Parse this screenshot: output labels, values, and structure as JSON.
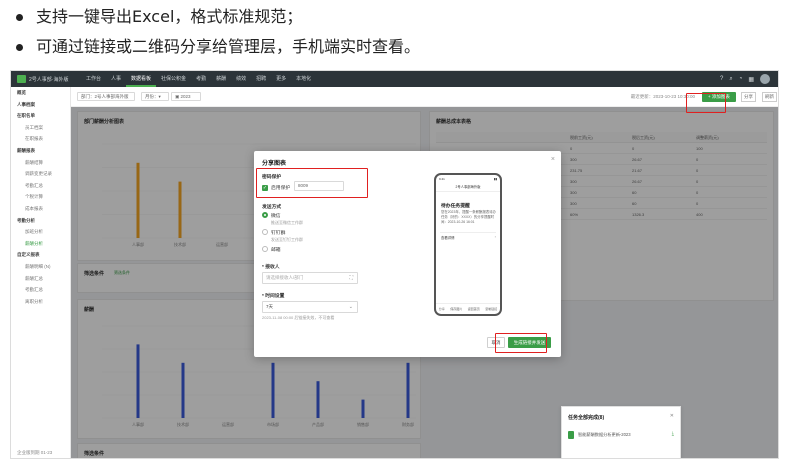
{
  "bullets": [
    "支持一键导出Excel，格式标准规范；",
    "可通过链接或二维码分享给管理层，手机端实时查看。"
  ],
  "topbar": {
    "app_name": "2号人事部·海外版",
    "nav": [
      "工作台",
      "人事",
      "数据看板",
      "社保公积金",
      "考勤",
      "薪酬",
      "绩效",
      "招聘",
      "更多",
      "本地化"
    ],
    "active_nav": "数据看板"
  },
  "sidebar": {
    "items": [
      {
        "label": "概览",
        "type": "group"
      },
      {
        "label": "人事档案",
        "type": "group"
      },
      {
        "label": "在职名单",
        "type": "group"
      },
      {
        "label": "员工档案",
        "type": "sub"
      },
      {
        "label": "在职报表",
        "type": "sub"
      },
      {
        "label": "薪酬报表",
        "type": "group"
      },
      {
        "label": "薪酬结算",
        "type": "sub"
      },
      {
        "label": "调薪变更记录",
        "type": "sub"
      },
      {
        "label": "考勤汇总",
        "type": "sub"
      },
      {
        "label": "个税计算",
        "type": "sub"
      },
      {
        "label": "成本报表",
        "type": "sub"
      },
      {
        "label": "考勤分析",
        "type": "group"
      },
      {
        "label": "加班分析",
        "type": "sub"
      },
      {
        "label": "薪酬分析",
        "type": "sub",
        "active": true
      },
      {
        "label": "自定义报表",
        "type": "group"
      },
      {
        "label": "薪酬明细 (N)",
        "type": "sub"
      },
      {
        "label": "薪酬汇总",
        "type": "sub"
      },
      {
        "label": "考勤汇总",
        "type": "sub"
      },
      {
        "label": "离职分析",
        "type": "sub"
      }
    ],
    "footer": "企业版到期 01-23"
  },
  "filters": {
    "dept": "部门：2号人事部海外版",
    "month": "月份：▾",
    "date": "2023",
    "updated": "最近更新：2023-10-23 10:30:00",
    "add_button": "+ 添加图表",
    "share_button": "分享",
    "refresh_button": "刷新"
  },
  "cards": {
    "left_top_title": "部门薪酬分析图表",
    "left_mid_title": "筛选条件",
    "left_mid_tag": "筛选条件",
    "left_bottom_title": "薪酬",
    "left_footer_title": "筛选条件",
    "right_top_title": "薪酬总成本表格"
  },
  "chart_data": [
    {
      "type": "bar",
      "categories": [
        "人事部",
        "技术部",
        "运营部"
      ],
      "values": [
        4,
        3,
        0
      ],
      "ylim": [
        0,
        5
      ]
    },
    {
      "type": "bar",
      "categories": [
        "人事部",
        "技术部",
        "运营部",
        "市场部",
        "产品部",
        "销售部",
        "财务部"
      ],
      "values": [
        4,
        3,
        0,
        3,
        2,
        1,
        3
      ],
      "ylim": [
        0,
        5
      ]
    }
  ],
  "table": {
    "columns": [
      "税前工资(元)",
      "税后工资(元)",
      "调整薪资(元)"
    ],
    "rows": [
      [
        "0",
        "0",
        "100"
      ],
      [
        "300",
        "26.67",
        "0"
      ],
      [
        "231.75",
        "21.67",
        "0"
      ],
      [
        "300",
        "26.67",
        "0"
      ],
      [
        "300",
        "60",
        "0"
      ],
      [
        "300",
        "60",
        "0"
      ],
      [
        "60%",
        "1326.3",
        "400"
      ]
    ]
  },
  "modal": {
    "title": "分享图表",
    "close": "×",
    "password_section": "密码保护",
    "password_checkbox_label": "启用保护",
    "password_value": "8009",
    "send_section": "发送方式",
    "radio_options": [
      {
        "label": "微信",
        "desc": "推送至微信工作群",
        "checked": true
      },
      {
        "label": "钉钉群",
        "desc": "发送至钉钉工作群",
        "checked": false
      },
      {
        "label": "邮箱",
        "desc": "",
        "checked": false
      }
    ],
    "recipient_label": "* 接收人",
    "recipient_placeholder": "请选择接收人/部门",
    "time_label": "* 时间设置",
    "time_value": "7天",
    "time_hint": "2023-11-08 00:00 后链接失效，不可查看",
    "cancel_button": "取消",
    "generate_button": "生成链接并发送"
  },
  "phone": {
    "status_left": "9:41",
    "status_right": "▮▮",
    "header": "2号人事部海外版",
    "card_title": "待办任务提醒",
    "card_body": "您在2023年，提醒一条薪酬报表待办任务（好的：XXXX）的分享提醒时间：2023-10-26 16:01",
    "link_label": "查看详情",
    "footer_items": [
      "分享",
      "保存图片",
      "返回首页",
      "复制链接"
    ]
  },
  "download_panel": {
    "title": "任务全部完成(8)",
    "file": "智能薪酬数据分析更新-2023"
  },
  "colors": {
    "accent": "#3a9d47",
    "highlight": "#e02020",
    "bar_orange": "#f5a623",
    "bar_blue": "#3b5bdb"
  }
}
